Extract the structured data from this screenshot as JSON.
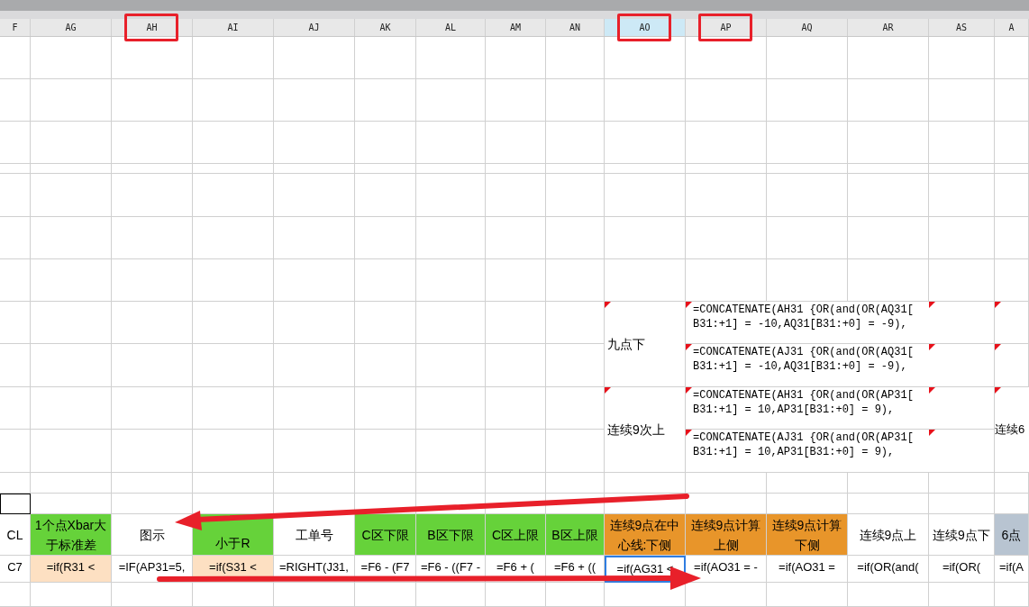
{
  "column_headers": [
    {
      "label": "F",
      "selected": false,
      "highlighted": false
    },
    {
      "label": "AG",
      "selected": false,
      "highlighted": false
    },
    {
      "label": "AH",
      "selected": false,
      "highlighted": true
    },
    {
      "label": "AI",
      "selected": false,
      "highlighted": false
    },
    {
      "label": "AJ",
      "selected": false,
      "highlighted": false
    },
    {
      "label": "AK",
      "selected": false,
      "highlighted": false
    },
    {
      "label": "AL",
      "selected": false,
      "highlighted": false
    },
    {
      "label": "AM",
      "selected": false,
      "highlighted": false
    },
    {
      "label": "AN",
      "selected": false,
      "highlighted": false
    },
    {
      "label": "AO",
      "selected": true,
      "highlighted": true
    },
    {
      "label": "AP",
      "selected": false,
      "highlighted": true
    },
    {
      "label": "AQ",
      "selected": false,
      "highlighted": false
    },
    {
      "label": "AR",
      "selected": false,
      "highlighted": false
    },
    {
      "label": "AS",
      "selected": false,
      "highlighted": false
    },
    {
      "label": "A",
      "selected": false,
      "highlighted": false
    }
  ],
  "notes": [
    {
      "text": "九点下",
      "comment": true
    },
    {
      "text": "连续9次上",
      "comment": true
    }
  ],
  "formulas": [
    {
      "text": "=CONCATENATE(AH31 {OR(and(OR(AQ31[ B31:+1] = -10,AQ31[B31:+0] = -9),",
      "comment": true
    },
    {
      "text": "=CONCATENATE(AJ31 {OR(and(OR(AQ31[ B31:+1] = -10,AQ31[B31:+0] = -9),",
      "comment": true
    },
    {
      "text": "=CONCATENATE(AH31 {OR(and(OR(AP31[ B31:+1] = 10,AP31[B31:+0] = 9),",
      "comment": true
    },
    {
      "text": "=CONCATENATE(AJ31 {OR(and(OR(AP31[ B31:+1] = 10,AP31[B31:+0] = 9),",
      "comment": true
    }
  ],
  "side_note": {
    "text": "连续6",
    "comment": true
  },
  "header_row": [
    {
      "text": "CL"
    },
    {
      "text": "1个点Xbar大于标准差",
      "color": "#66d23a"
    },
    {
      "text": "图示"
    },
    {
      "text": "小于R",
      "color": "#66d23a",
      "partly_hidden": true
    },
    {
      "text": "工单号"
    },
    {
      "text": "C区下限",
      "color": "#66d23a"
    },
    {
      "text": "B区下限",
      "color": "#66d23a"
    },
    {
      "text": "C区上限",
      "color": "#66d23a"
    },
    {
      "text": "B区上限",
      "color": "#66d23a"
    },
    {
      "text": "连续9点在中心线:下侧",
      "color": "#e8952a"
    },
    {
      "text": "连续9点计算上侧",
      "color": "#e8952a"
    },
    {
      "text": "连续9点计算下侧",
      "color": "#e8952a"
    },
    {
      "text": "连续9点上"
    },
    {
      "text": "连续9点下"
    },
    {
      "text": "6点",
      "color": "#b8c4d1"
    }
  ],
  "formula_row": [
    {
      "text": "C7",
      "selected": false
    },
    {
      "text": "=if(R31 <",
      "color": "#fde0c2",
      "selected": false
    },
    {
      "text": "=IF(AP31=5,",
      "selected": false
    },
    {
      "text": "=if(S31 <",
      "color": "#fde0c2",
      "selected": false
    },
    {
      "text": "=RIGHT(J31,",
      "selected": false
    },
    {
      "text": "=F6 - (F7",
      "selected": false
    },
    {
      "text": "=F6 - ((F7 -",
      "selected": false
    },
    {
      "text": "=F6 + (",
      "selected": false
    },
    {
      "text": "=F6 + ((",
      "selected": false
    },
    {
      "text": "=if(AG31 <",
      "selected": true
    },
    {
      "text": "=if(AO31 = -",
      "selected": false
    },
    {
      "text": "=if(AO31 =",
      "selected": false
    },
    {
      "text": "=if(OR(and(",
      "selected": false
    },
    {
      "text": "=if(OR(",
      "selected": false
    },
    {
      "text": "=if(A",
      "selected": false
    }
  ]
}
